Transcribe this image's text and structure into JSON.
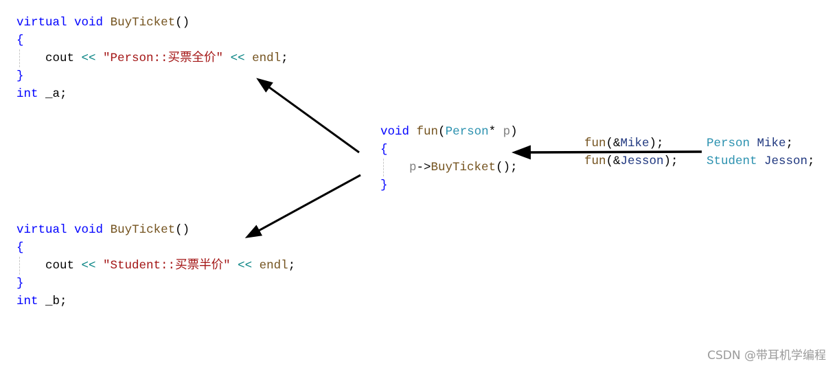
{
  "blocks": [
    {
      "id": "person-buyticket",
      "lines": [
        [
          [
            "kw",
            "virtual"
          ],
          [
            "pl",
            " "
          ],
          [
            "kw",
            "void"
          ],
          [
            "pl",
            " "
          ],
          [
            "fn",
            "BuyTicket"
          ],
          [
            "pl",
            "()"
          ]
        ],
        [
          [
            "kw",
            "{"
          ]
        ],
        [
          [
            "pl",
            "    cout "
          ],
          [
            "op",
            "<<"
          ],
          [
            "pl",
            " "
          ],
          [
            "str",
            "\"Person::买票全价\""
          ],
          [
            "pl",
            " "
          ],
          [
            "op",
            "<<"
          ],
          [
            "pl",
            " "
          ],
          [
            "fn",
            "endl"
          ],
          [
            "pl",
            ";"
          ]
        ],
        [
          [
            "kw",
            "}"
          ]
        ],
        [
          [
            "kw",
            "int"
          ],
          [
            "pl",
            " _a;"
          ]
        ]
      ]
    },
    {
      "id": "student-buyticket",
      "lines": [
        [
          [
            "kw",
            "virtual"
          ],
          [
            "pl",
            " "
          ],
          [
            "kw",
            "void"
          ],
          [
            "pl",
            " "
          ],
          [
            "fn",
            "BuyTicket"
          ],
          [
            "pl",
            "()"
          ]
        ],
        [
          [
            "kw",
            "{"
          ]
        ],
        [
          [
            "pl",
            "    cout "
          ],
          [
            "op",
            "<<"
          ],
          [
            "pl",
            " "
          ],
          [
            "str",
            "\"Student::买票半价\""
          ],
          [
            "pl",
            " "
          ],
          [
            "op",
            "<<"
          ],
          [
            "pl",
            " "
          ],
          [
            "fn",
            "endl"
          ],
          [
            "pl",
            ";"
          ]
        ],
        [
          [
            "kw",
            "}"
          ]
        ],
        [
          [
            "kw",
            "int"
          ],
          [
            "pl",
            " _b;"
          ]
        ]
      ]
    },
    {
      "id": "fun-definition",
      "lines": [
        [
          [
            "kw",
            "void"
          ],
          [
            "pl",
            " "
          ],
          [
            "fn",
            "fun"
          ],
          [
            "pl",
            "("
          ],
          [
            "ty",
            "Person"
          ],
          [
            "pl",
            "* "
          ],
          [
            "par",
            "p"
          ],
          [
            "pl",
            ")"
          ]
        ],
        [
          [
            "kw",
            "{"
          ]
        ],
        [
          [
            "pl",
            "    "
          ],
          [
            "par",
            "p"
          ],
          [
            "pl",
            "->"
          ],
          [
            "fn",
            "BuyTicket"
          ],
          [
            "pl",
            "();"
          ]
        ],
        [
          [
            "kw",
            "}"
          ]
        ]
      ]
    },
    {
      "id": "fun-calls",
      "lines": [
        [
          [
            "fn",
            "fun"
          ],
          [
            "pl",
            "(&"
          ],
          [
            "var",
            "Mike"
          ],
          [
            "pl",
            ");"
          ]
        ],
        [
          [
            "fn",
            "fun"
          ],
          [
            "pl",
            "(&"
          ],
          [
            "var",
            "Jesson"
          ],
          [
            "pl",
            ");"
          ]
        ]
      ]
    },
    {
      "id": "object-declarations",
      "lines": [
        [
          [
            "ty",
            "Person"
          ],
          [
            "pl",
            " "
          ],
          [
            "var",
            "Mike"
          ],
          [
            "pl",
            ";"
          ]
        ],
        [
          [
            "ty",
            "Student"
          ],
          [
            "pl",
            " "
          ],
          [
            "var",
            "Jesson"
          ],
          [
            "pl",
            ";"
          ]
        ]
      ]
    }
  ],
  "watermark": "CSDN @带耳机学编程",
  "colors": {
    "keyword": "#0000ff",
    "function": "#74531f",
    "string": "#a31515",
    "type": "#2b91af",
    "variable": "#1f377f",
    "operator": "#008080",
    "parameter": "#808080",
    "arrow": "#000000"
  }
}
